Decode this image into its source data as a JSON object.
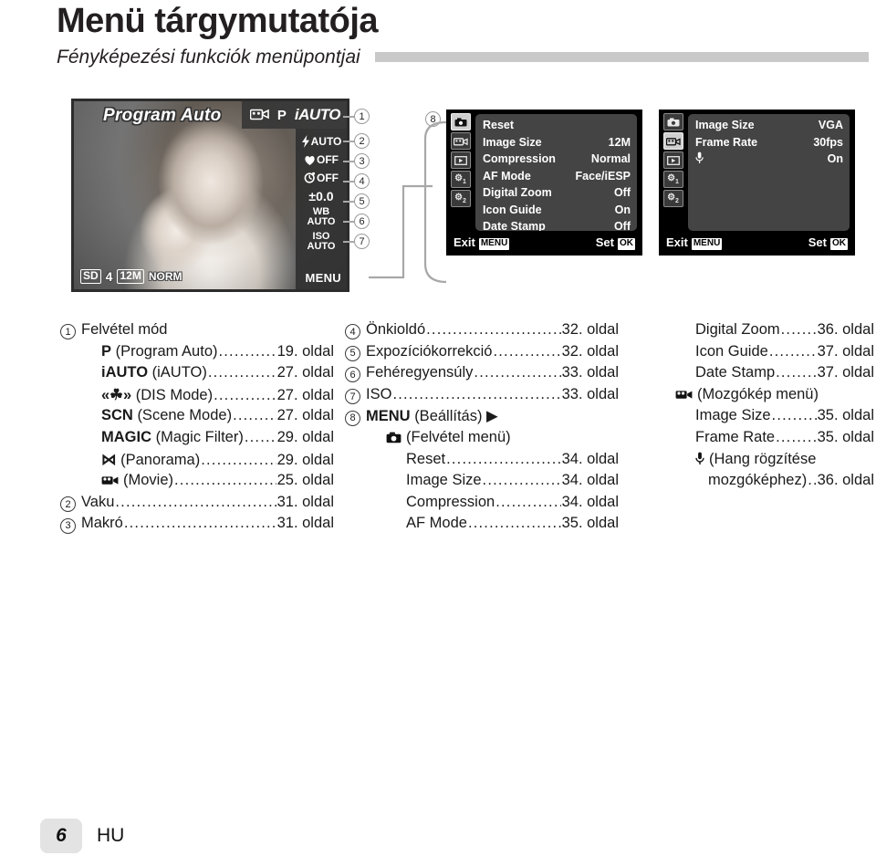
{
  "header": {
    "title": "Menü tárgymutatója",
    "subtitle": "Fényképezési funkciók menüpontjai"
  },
  "lcd": {
    "mode_banner": "Program Auto",
    "top_icons": [
      "movie-icon",
      "P"
    ],
    "iauto_badge": "iAUTO",
    "strip": [
      {
        "name": "flash-auto",
        "icon": "flash",
        "value": "AUTO"
      },
      {
        "name": "macro-off",
        "icon": "macro",
        "value": "OFF"
      },
      {
        "name": "selftimer-off",
        "icon": "timer",
        "value": "OFF"
      },
      {
        "name": "exposure-comp",
        "icon": "",
        "value": "±0.0"
      },
      {
        "name": "white-balance",
        "icon": "",
        "value": "WB AUTO"
      },
      {
        "name": "iso",
        "icon": "",
        "value": "ISO AUTO"
      }
    ],
    "menu_label": "MENU",
    "status": {
      "card": "SD",
      "battery": "4",
      "image_size": "12M",
      "quality": "NORM"
    }
  },
  "callouts": [
    "1",
    "2",
    "3",
    "4",
    "5",
    "6",
    "7",
    "8"
  ],
  "panels": [
    {
      "name": "rec-menu",
      "tabs": [
        "camera-icon",
        "movie-icon",
        "playback-icon",
        "wrench1-icon",
        "wrench2-icon"
      ],
      "selected_tab": 0,
      "rows": [
        {
          "label": "Reset",
          "value": ""
        },
        {
          "label": "Image Size",
          "value": "12M"
        },
        {
          "label": "Compression",
          "value": "Normal"
        },
        {
          "label": "AF Mode",
          "value": "Face/iESP"
        },
        {
          "label": "Digital Zoom",
          "value": "Off"
        },
        {
          "label": "Icon Guide",
          "value": "On"
        },
        {
          "label": "Date Stamp",
          "value": "Off"
        }
      ],
      "footer": {
        "exit": "Exit",
        "exit_key": "MENU",
        "set": "Set",
        "set_key": "OK"
      }
    },
    {
      "name": "movie-menu",
      "tabs": [
        "camera-icon",
        "movie-icon",
        "playback-icon",
        "wrench1-icon",
        "wrench2-icon"
      ],
      "selected_tab": 1,
      "rows": [
        {
          "label": "Image Size",
          "value": "VGA"
        },
        {
          "label": "Frame Rate",
          "value": "30fps"
        },
        {
          "label": "mic-icon",
          "value": "On"
        }
      ],
      "footer": {
        "exit": "Exit",
        "exit_key": "MENU",
        "set": "Set",
        "set_key": "OK"
      }
    }
  ],
  "index": {
    "column1": [
      {
        "num": "1",
        "label": "Felvétel mód",
        "page": "",
        "indent": 0
      },
      {
        "num": "",
        "icon": "P",
        "label": "(Program Auto)",
        "page": "19. oldal",
        "indent": 1
      },
      {
        "num": "",
        "icon": "iAUTO",
        "label": "(iAUTO)",
        "page": "27. oldal",
        "indent": 1
      },
      {
        "num": "",
        "icon": "«☘»",
        "label": "(DIS Mode)",
        "page": "27. oldal",
        "indent": 1
      },
      {
        "num": "",
        "icon": "SCN",
        "label": "(Scene Mode)",
        "page": "27. oldal",
        "indent": 1
      },
      {
        "num": "",
        "icon": "MAGIC",
        "label": "(Magic Filter)",
        "page": "29. oldal",
        "indent": 1
      },
      {
        "num": "",
        "icon": "⋈",
        "label": "(Panorama)",
        "page": "29. oldal",
        "indent": 1
      },
      {
        "num": "",
        "icon": "movie",
        "label": "(Movie)",
        "page": "25. oldal",
        "indent": 1
      },
      {
        "num": "2",
        "label": "Vaku",
        "page": "31. oldal",
        "indent": 0
      },
      {
        "num": "3",
        "label": "Makró",
        "page": "31. oldal",
        "indent": 0
      }
    ],
    "column2": [
      {
        "num": "4",
        "label": "Önkioldó",
        "page": "32. oldal",
        "indent": 0
      },
      {
        "num": "5",
        "label": "Expozíciókorrekció",
        "page": "32. oldal",
        "indent": 0
      },
      {
        "num": "6",
        "label": "Fehéregyensúly",
        "page": "33. oldal",
        "indent": 0
      },
      {
        "num": "7",
        "label": "ISO",
        "page": "33. oldal",
        "indent": 0
      },
      {
        "num": "8",
        "icon": "MENU",
        "label": "(Beállítás) ▶",
        "page": "",
        "indent": 0
      },
      {
        "num": "",
        "icon": "camera",
        "label": "(Felvétel menü)",
        "page": "",
        "indent": 1
      },
      {
        "num": "",
        "label": "Reset",
        "page": "34. oldal",
        "indent": 2
      },
      {
        "num": "",
        "label": "Image Size",
        "page": "34. oldal",
        "indent": 2
      },
      {
        "num": "",
        "label": "Compression",
        "page": "34. oldal",
        "indent": 2
      },
      {
        "num": "",
        "label": "AF Mode",
        "page": "35. oldal",
        "indent": 2
      }
    ],
    "column3": [
      {
        "label": "Digital Zoom",
        "page": "36. oldal",
        "indent": 2
      },
      {
        "label": "Icon Guide",
        "page": "37. oldal",
        "indent": 2
      },
      {
        "label": "Date Stamp",
        "page": "37. oldal",
        "indent": 2
      },
      {
        "icon": "movie",
        "label": "(Mozgókép menü)",
        "page": "",
        "indent": 1
      },
      {
        "label": "Image Size",
        "page": "35. oldal",
        "indent": 2
      },
      {
        "label": "Frame Rate",
        "page": "35. oldal",
        "indent": 2
      },
      {
        "icon": "mic",
        "label": "(Hang rögzítése",
        "page": "",
        "indent": 2
      },
      {
        "label": "mozgóképhez)",
        "page": "36. oldal",
        "indent": 3
      }
    ]
  },
  "footer": {
    "page_number": "6",
    "language": "HU"
  }
}
